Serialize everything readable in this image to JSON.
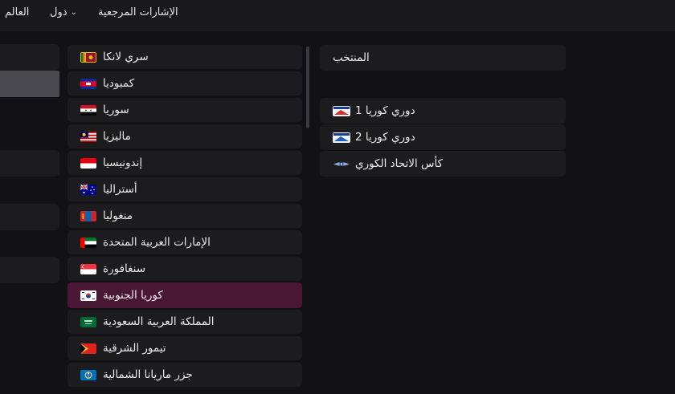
{
  "topbar": {
    "world": "العالم",
    "countries": "دول",
    "bookmarks": "الإشارات المرجعية"
  },
  "countries": [
    {
      "name": "سري لانكا",
      "flag": "sri-lanka-flag-icon"
    },
    {
      "name": "كمبوديا",
      "flag": "cambodia-flag-icon"
    },
    {
      "name": "سوريا",
      "flag": "syria-flag-icon"
    },
    {
      "name": "ماليزيا",
      "flag": "malaysia-flag-icon"
    },
    {
      "name": "إندونيسيا",
      "flag": "indonesia-flag-icon"
    },
    {
      "name": "أستراليا",
      "flag": "australia-flag-icon"
    },
    {
      "name": "منغوليا",
      "flag": "mongolia-flag-icon"
    },
    {
      "name": "الإمارات العربية المتحدة",
      "flag": "uae-flag-icon"
    },
    {
      "name": "سنغافورة",
      "flag": "singapore-flag-icon"
    },
    {
      "name": "كوريا الجنوبية",
      "flag": "south-korea-flag-icon",
      "selected": true
    },
    {
      "name": "المملكة العربية السعودية",
      "flag": "saudi-arabia-flag-icon"
    },
    {
      "name": "تيمور الشرقية",
      "flag": "east-timor-flag-icon"
    },
    {
      "name": "جزر ماريانا الشمالية",
      "flag": "northern-mariana-flag-icon"
    }
  ],
  "competitions": {
    "header": "المنتخب",
    "items": [
      {
        "name": "دوري كوريا 1",
        "icon": "k-league-1-logo-icon"
      },
      {
        "name": "دوري كوريا 2",
        "icon": "k-league-2-logo-icon"
      },
      {
        "name": "كأس الاتحاد الكوري",
        "icon": "korea-fa-cup-logo-icon"
      }
    ]
  },
  "colors": {
    "background": "#121214",
    "row": "#1c1c1f",
    "selected_row": "#4a1834"
  }
}
